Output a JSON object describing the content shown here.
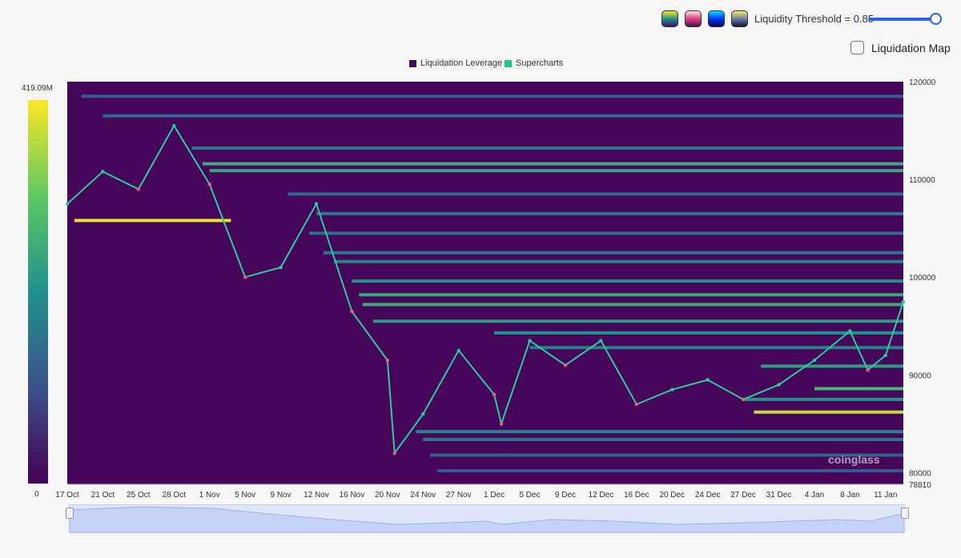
{
  "controls": {
    "palettes": [
      "viridis-palette-icon",
      "pink-palette-icon",
      "blue-palette-icon",
      "gold-palette-icon"
    ],
    "threshold_label": "Liquidity Threshold = 0.85",
    "threshold_value": 0.85,
    "liquidation_map_label": "Liquidation Map",
    "liquidation_map_checked": false
  },
  "legend": [
    {
      "label": "Liquidation Leverage",
      "color": "#3b0f5e"
    },
    {
      "label": "Supercharts",
      "color": "#22c58b"
    }
  ],
  "colorbar": {
    "max_label": "419.09M",
    "min_label": "0"
  },
  "watermark": "coinglass",
  "chart_data": {
    "type": "heatmap",
    "title": "",
    "xlabel": "",
    "ylabel": "",
    "ylim": [
      78810,
      120000
    ],
    "y_ticks": [
      "120000",
      "110000",
      "100000",
      "90000",
      "80000",
      "78810"
    ],
    "x_ticks": [
      "17 Oct",
      "21 Oct",
      "25 Oct",
      "28 Oct",
      "1 Nov",
      "5 Nov",
      "9 Nov",
      "12 Nov",
      "16 Nov",
      "20 Nov",
      "24 Nov",
      "27 Nov",
      "1 Dec",
      "5 Dec",
      "9 Dec",
      "12 Dec",
      "16 Dec",
      "20 Dec",
      "24 Dec",
      "27 Dec",
      "31 Dec",
      "4 Jan",
      "8 Jan",
      "11 Jan"
    ],
    "colorscale": {
      "min": 0,
      "max": 419090000,
      "max_label": "419.09M",
      "min_label": "0"
    },
    "background_color": "#46075a",
    "liquidity_bands": [
      {
        "price": 118500,
        "start_index": 0.4,
        "intensity": 0.3
      },
      {
        "price": 116500,
        "start_index": 1.0,
        "intensity": 0.35
      },
      {
        "price": 113200,
        "start_index": 3.5,
        "intensity": 0.42
      },
      {
        "price": 111600,
        "start_index": 3.8,
        "intensity": 0.62
      },
      {
        "price": 110900,
        "start_index": 4.0,
        "intensity": 0.58
      },
      {
        "price": 108500,
        "start_index": 6.2,
        "intensity": 0.35
      },
      {
        "price": 106500,
        "start_index": 7.0,
        "intensity": 0.4
      },
      {
        "price": 105800,
        "start_index": 0.2,
        "end_index": 4.6,
        "intensity": 0.97
      },
      {
        "price": 104500,
        "start_index": 6.8,
        "intensity": 0.36
      },
      {
        "price": 102500,
        "start_index": 7.2,
        "intensity": 0.4
      },
      {
        "price": 101600,
        "start_index": 7.5,
        "intensity": 0.46
      },
      {
        "price": 99600,
        "start_index": 8.0,
        "intensity": 0.5
      },
      {
        "price": 98200,
        "start_index": 8.2,
        "intensity": 0.6
      },
      {
        "price": 97200,
        "start_index": 8.3,
        "intensity": 0.62
      },
      {
        "price": 95500,
        "start_index": 8.6,
        "intensity": 0.55
      },
      {
        "price": 94300,
        "start_index": 12.0,
        "intensity": 0.5
      },
      {
        "price": 92800,
        "start_index": 13.0,
        "intensity": 0.42
      },
      {
        "price": 90900,
        "start_index": 19.5,
        "intensity": 0.55
      },
      {
        "price": 88600,
        "start_index": 21.0,
        "intensity": 0.66
      },
      {
        "price": 87500,
        "start_index": 19.0,
        "intensity": 0.5
      },
      {
        "price": 86200,
        "start_index": 19.3,
        "intensity": 0.9
      },
      {
        "price": 84200,
        "start_index": 9.8,
        "intensity": 0.45
      },
      {
        "price": 83400,
        "start_index": 10.0,
        "intensity": 0.4
      },
      {
        "price": 81800,
        "start_index": 10.2,
        "intensity": 0.32
      },
      {
        "price": 80200,
        "start_index": 10.4,
        "intensity": 0.28
      }
    ],
    "price_path": [
      [
        0,
        107500
      ],
      [
        1,
        110800
      ],
      [
        2,
        109000
      ],
      [
        3,
        115500
      ],
      [
        4,
        109500
      ],
      [
        5,
        100000
      ],
      [
        6,
        101000
      ],
      [
        7,
        107500
      ],
      [
        8,
        96500
      ],
      [
        9,
        91500
      ],
      [
        9.2,
        82000
      ],
      [
        10,
        86000
      ],
      [
        11,
        92500
      ],
      [
        12,
        88000
      ],
      [
        12.2,
        85000
      ],
      [
        13,
        93500
      ],
      [
        14,
        91000
      ],
      [
        15,
        93500
      ],
      [
        16,
        87000
      ],
      [
        17,
        88500
      ],
      [
        18,
        89500
      ],
      [
        19,
        87500
      ],
      [
        20,
        89000
      ],
      [
        21,
        91500
      ],
      [
        22,
        94500
      ],
      [
        22.5,
        90500
      ],
      [
        23,
        92000
      ],
      [
        23.5,
        97500
      ]
    ]
  }
}
